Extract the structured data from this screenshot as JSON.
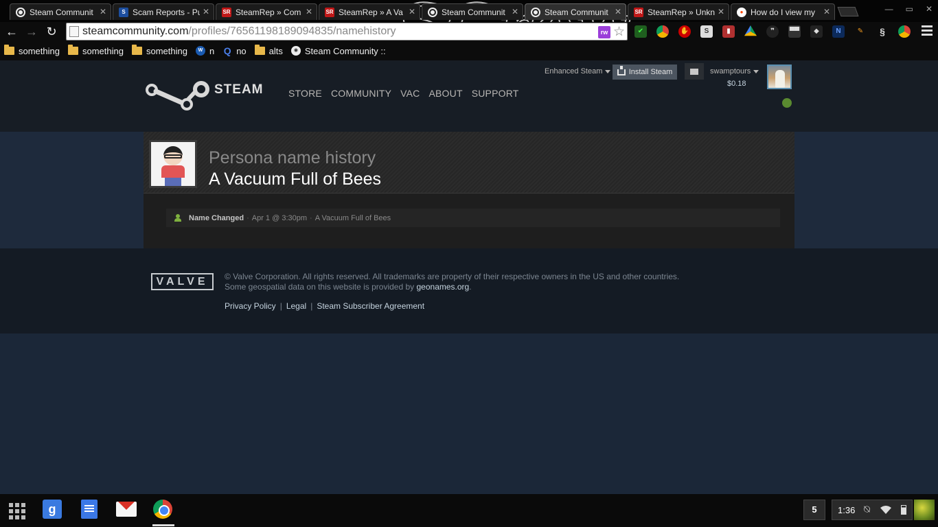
{
  "browser": {
    "tabs": [
      {
        "title": "Steam Communit",
        "favicon": "steam-icon",
        "active": false
      },
      {
        "title": "Scam Reports - Pu",
        "favicon": "scam-report-icon",
        "active": false
      },
      {
        "title": "SteamRep » Com",
        "favicon": "steamrep-icon",
        "active": false
      },
      {
        "title": "SteamRep » A Va",
        "favicon": "steamrep-icon",
        "active": false
      },
      {
        "title": "Steam Communit",
        "favicon": "steam-icon",
        "active": false
      },
      {
        "title": "Steam Communit",
        "favicon": "steam-icon",
        "active": true
      },
      {
        "title": "SteamRep » Unkn",
        "favicon": "steamrep-icon",
        "active": false
      },
      {
        "title": "How do I view my",
        "favicon": "reddit-icon",
        "active": false
      }
    ],
    "url": {
      "host": "steamcommunity.com",
      "path": "/profiles/76561198189094835/namehistory"
    },
    "bookmarks": [
      {
        "label": "something",
        "icon": "folder-icon"
      },
      {
        "label": "something",
        "icon": "folder-icon"
      },
      {
        "label": "something",
        "icon": "folder-icon"
      },
      {
        "label": "n",
        "icon": "wow-icon"
      },
      {
        "label": "no",
        "icon": "quora-icon"
      },
      {
        "label": "alts",
        "icon": "folder-icon"
      },
      {
        "label": "Steam Community :: ",
        "icon": "steam-icon"
      }
    ]
  },
  "steam": {
    "logo_text": "STEAM",
    "nav": [
      "STORE",
      "COMMUNITY",
      "VAC",
      "ABOUT",
      "SUPPORT"
    ],
    "enhanced_steam": "Enhanced Steam",
    "install_steam": "Install Steam",
    "username": "swamptours",
    "balance": "$0.18"
  },
  "profile": {
    "section_title": "Persona name history",
    "persona_name": "A Vacuum Full of Bees"
  },
  "history": [
    {
      "label": "Name Changed",
      "date": "Apr 1 @ 3:30pm",
      "name": "A Vacuum Full of Bees"
    }
  ],
  "footer": {
    "valve_logo": "VALVE",
    "copyright": "© Valve Corporation. All rights reserved. All trademarks are property of their respective owners in the US and other countries.",
    "geo_prefix": "Some geospatial data on this website is provided by ",
    "geo_link": "geonames.org",
    "geo_suffix": ".",
    "links": [
      "Privacy Policy",
      "Legal",
      "Steam Subscriber Agreement"
    ]
  },
  "shelf": {
    "notification_count": "5",
    "time": "1:36"
  },
  "colors": {
    "steam_header_bg": "#171d25",
    "steam_page_bg": "#1b2738",
    "online_green": "#5a8a30",
    "name_changed_icon": "#7fb13f"
  }
}
